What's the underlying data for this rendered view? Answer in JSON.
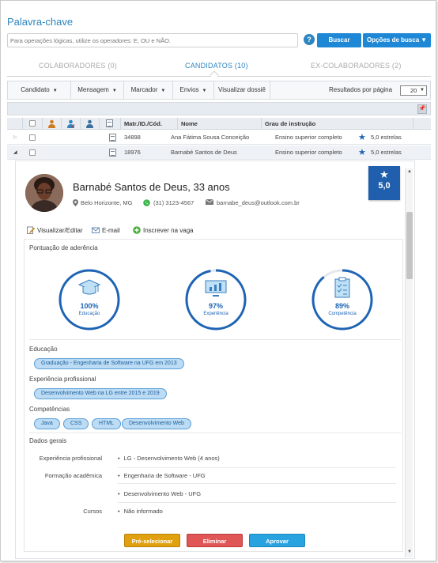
{
  "search": {
    "title": "Palavra-chave",
    "placeholder": "Para operações lógicas, utilize os operadores: E, OU e NÃO.",
    "help": "?",
    "search_button": "Buscar",
    "options_button": "Opções de busca"
  },
  "tabs": [
    {
      "label": "COLABORADORES (0)",
      "active": false
    },
    {
      "label": "CANDIDATOS (10)",
      "active": true
    },
    {
      "label": "EX-COLABORADORES (2)",
      "active": false
    }
  ],
  "toolbar": {
    "candidato": "Candidato",
    "mensagem": "Mensagem",
    "marcador": "Marcador",
    "envios": "Envios",
    "dossie": "Visualizar dossiê",
    "results_per_page_label": "Resultados por página",
    "results_per_page": "20"
  },
  "table": {
    "headers": {
      "id": "Matr./ID./Cód.",
      "name": "Nome",
      "education": "Grau de instrução"
    },
    "rows": [
      {
        "id": "34898",
        "name": "Ana Fátima Sousa Conceição",
        "education": "Ensino superior completo",
        "rating": "5,0 estrelas"
      },
      {
        "id": "18976",
        "name": "Barnabé Santos de Deus",
        "education": "Ensino superior completo",
        "rating": "5,0 estrelas"
      }
    ]
  },
  "candidate": {
    "name": "Barnabé Santos de Deus, 33 anos",
    "location": "Belo Horizonte, MG",
    "phone": "(31) 3123-4567",
    "email": "barnabe_deus@outlook.com.br",
    "score": "5,0",
    "actions": {
      "edit": "Visualizar/Editar",
      "email": "E-mail",
      "enroll": "Inscrever na vaga"
    }
  },
  "adherence": {
    "title": "Pontuação de aderência",
    "gauges": [
      {
        "percent": 100,
        "label_value": "100%",
        "label": "Educação",
        "icon": "graduation-cap-icon"
      },
      {
        "percent": 97,
        "label_value": "97%",
        "label": "Experiência",
        "icon": "bar-chart-monitor-icon"
      },
      {
        "percent": 89,
        "label_value": "89%",
        "label": "Competência",
        "icon": "checklist-icon"
      }
    ]
  },
  "education": {
    "title": "Educação",
    "items": [
      "Graduação - Engenharia de Software na UFG em 2013"
    ]
  },
  "experience": {
    "title": "Experiência profissional",
    "items": [
      "Desenvolvimento Web na LG entre 2015 e 2019"
    ]
  },
  "skills": {
    "title": "Competências",
    "items": [
      "Java",
      "CSS",
      "HTML",
      "Desenvolvimento Web"
    ]
  },
  "general": {
    "title": "Dados gerais",
    "experience_label": "Experiência profissional",
    "experience_value": "LG - Desenvolvimento Web (4 anos)",
    "formation_label": "Formação acadêmica",
    "formation_values": [
      "Engenharia de Software - UFG",
      "Desenvolvimento Web - UFG"
    ],
    "courses_label": "Cursos",
    "courses_value": "Não informado"
  },
  "buttons": {
    "preselect": "Pré-selecionar",
    "eliminate": "Eliminar",
    "approve": "Aprovar"
  },
  "colors": {
    "primary": "#1e88d6",
    "dark_blue": "#1f5fad",
    "preselect": "#e0a010",
    "eliminate": "#e05555",
    "approve": "#29a3e0"
  }
}
